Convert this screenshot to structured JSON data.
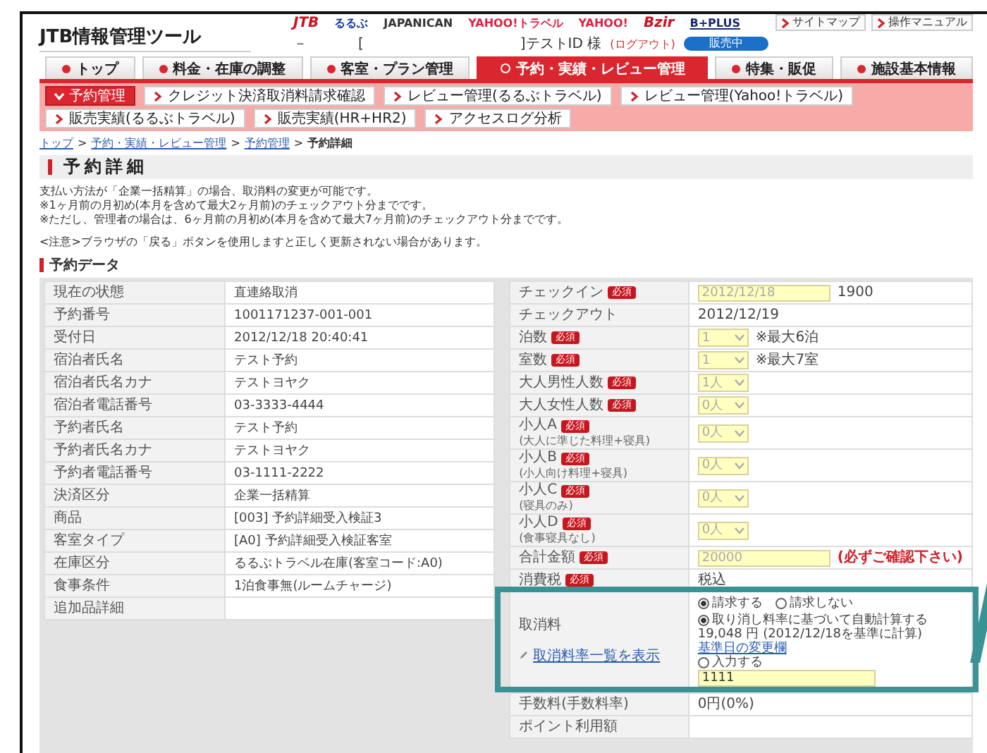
{
  "header": {
    "logo": "JTB情報管理ツール",
    "partners": [
      {
        "label": "JTB",
        "color": "#cc1122"
      },
      {
        "label": "るるぶ",
        "color": "#1a3f9a"
      },
      {
        "label": "JAPANICAN",
        "color": "#333333"
      },
      {
        "label": "YAHOO!トラベル",
        "color": "#dd2244"
      },
      {
        "label": "YAHOO!",
        "color": "#dd2244"
      },
      {
        "label": "Bzir",
        "color": "#cc1122"
      },
      {
        "label": "B+PLUS",
        "color": "#1a2a6a"
      }
    ],
    "links": [
      "サイトマップ",
      "操作マニュアル"
    ],
    "user_line": {
      "dash": "－",
      "open": "[",
      "user": "]テストID 様",
      "logout": "(ログアウト)",
      "status": "販売中"
    }
  },
  "tabs": [
    {
      "label": "トップ",
      "selected": false
    },
    {
      "label": "料金・在庫の調整",
      "selected": false
    },
    {
      "label": "客室・プラン管理",
      "selected": false
    },
    {
      "label": "予約・実績・レビュー管理",
      "selected": true
    },
    {
      "label": "特集・販促",
      "selected": false
    },
    {
      "label": "施設基本情報",
      "selected": false
    }
  ],
  "subnav": [
    [
      {
        "label": "予約管理",
        "selected": true
      },
      {
        "label": "クレジット決済取消料請求確認",
        "selected": false
      },
      {
        "label": "レビュー管理(るるぶトラベル)",
        "selected": false
      },
      {
        "label": "レビュー管理(Yahoo!トラベル)",
        "selected": false
      }
    ],
    [
      {
        "label": "販売実績(るるぶトラベル)",
        "selected": false
      },
      {
        "label": "販売実績(HR+HR2)",
        "selected": false
      },
      {
        "label": "アクセスログ分析",
        "selected": false
      }
    ]
  ],
  "breadcrumb": [
    {
      "label": "トップ",
      "sep": ">"
    },
    {
      "label": "予約・実績・レビュー管理",
      "sep": ">"
    },
    {
      "label": "予約管理",
      "sep": ">"
    },
    {
      "label": "予約詳細"
    }
  ],
  "page_title": "予約詳細",
  "notices": [
    "支払い方法が「企業一括精算」の場合、取消料の変更が可能です。",
    "※1ヶ月前の月初め(本月を含めて最大2ヶ月前)のチェックアウト分までです。",
    "※ただし、管理者の場合は、6ヶ月前の月初め(本月を含めて最大7ヶ月前)のチェックアウト分までです。"
  ],
  "caution": "<注意>ブラウザの「戻る」ボタンを使用しますと正しく更新されない場合があります。",
  "section_title": "予約データ",
  "left_rows": [
    {
      "label": "現在の状態",
      "value": "直連絡取消"
    },
    {
      "label": "予約番号",
      "value": "1001171237-001-001"
    },
    {
      "label": "受付日",
      "value": "2012/12/18 20:40:41"
    },
    {
      "label": "宿泊者氏名",
      "value": "テスト予約"
    },
    {
      "label": "宿泊者氏名カナ",
      "value": "テストヨヤク"
    },
    {
      "label": "宿泊者電話番号",
      "value": "03-3333-4444"
    },
    {
      "label": "予約者氏名",
      "value": "テスト予約"
    },
    {
      "label": "予約者氏名カナ",
      "value": "テストヨヤク"
    },
    {
      "label": "予約者電話番号",
      "value": "03-1111-2222"
    },
    {
      "label": "決済区分",
      "value": "企業一括精算"
    },
    {
      "label": "商品",
      "value": "[003] 予約詳細受入検証3"
    },
    {
      "label": "客室タイプ",
      "value": "[A0] 予約詳細受入検証客室"
    },
    {
      "label": "在庫区分",
      "value": "るるぶトラベル在庫(客室コード:A0)"
    },
    {
      "label": "食事条件",
      "value": "1泊食事無(ルームチャージ)"
    },
    {
      "label": "追加品詳細"
    }
  ],
  "right_rows": [
    {
      "kind": "checkin",
      "label": "チェックイン",
      "badge": "必須",
      "input": "2012/12/18",
      "text": "1900"
    },
    {
      "kind": "text",
      "label": "チェックアウト",
      "text": "2012/12/19"
    },
    {
      "kind": "select",
      "label": "泊数",
      "badge": "必須",
      "select": "1",
      "note": "※最大6泊"
    },
    {
      "kind": "select",
      "label": "室数",
      "badge": "必須",
      "select": "1",
      "note": "※最大7室"
    },
    {
      "kind": "select",
      "label": "大人男性人数",
      "badge": "必須",
      "select": "1人"
    },
    {
      "kind": "select",
      "label": "大人女性人数",
      "badge": "必須",
      "select": "0人"
    },
    {
      "kind": "select",
      "label": "小人A",
      "badge": "必須",
      "sublabel": "(大人に準じた料理+寝具)",
      "select": "0人"
    },
    {
      "kind": "select",
      "label": "小人B",
      "badge": "必須",
      "sublabel": "(小人向け料理+寝具)",
      "select": "0人"
    },
    {
      "kind": "select",
      "label": "小人C",
      "badge": "必須",
      "sublabel": "(寝具のみ)",
      "select": "0人"
    },
    {
      "kind": "select",
      "label": "小人D",
      "badge": "必須",
      "sublabel": "(食事寝具なし)",
      "select": "0人"
    },
    {
      "kind": "amount",
      "label": "合計金額",
      "badge": "必須",
      "input": "20000",
      "note": "(必ずご確認下さい)"
    },
    {
      "kind": "text",
      "label": "消費税",
      "badge": "必須",
      "text": "税込"
    },
    {
      "kind": "cancel",
      "label": "取消料",
      "link": "取消料率一覧を表示",
      "charge": [
        {
          "label": "請求する",
          "selected": true
        },
        {
          "label": "請求しない",
          "selected": false
        }
      ],
      "auto": {
        "label": "取り消し料率に基づいて自動計算する",
        "selected": true
      },
      "calc": "19,048 円 (2012/12/18を基準に計算)",
      "date_link": "基準日の変更欄",
      "manual": {
        "label": "入力する",
        "selected": false
      },
      "input": "1111"
    },
    {
      "kind": "text",
      "label": "手数料(手数料率)",
      "text": "0円(0%)"
    },
    {
      "kind": "text",
      "label": "ポイント利用額"
    }
  ]
}
